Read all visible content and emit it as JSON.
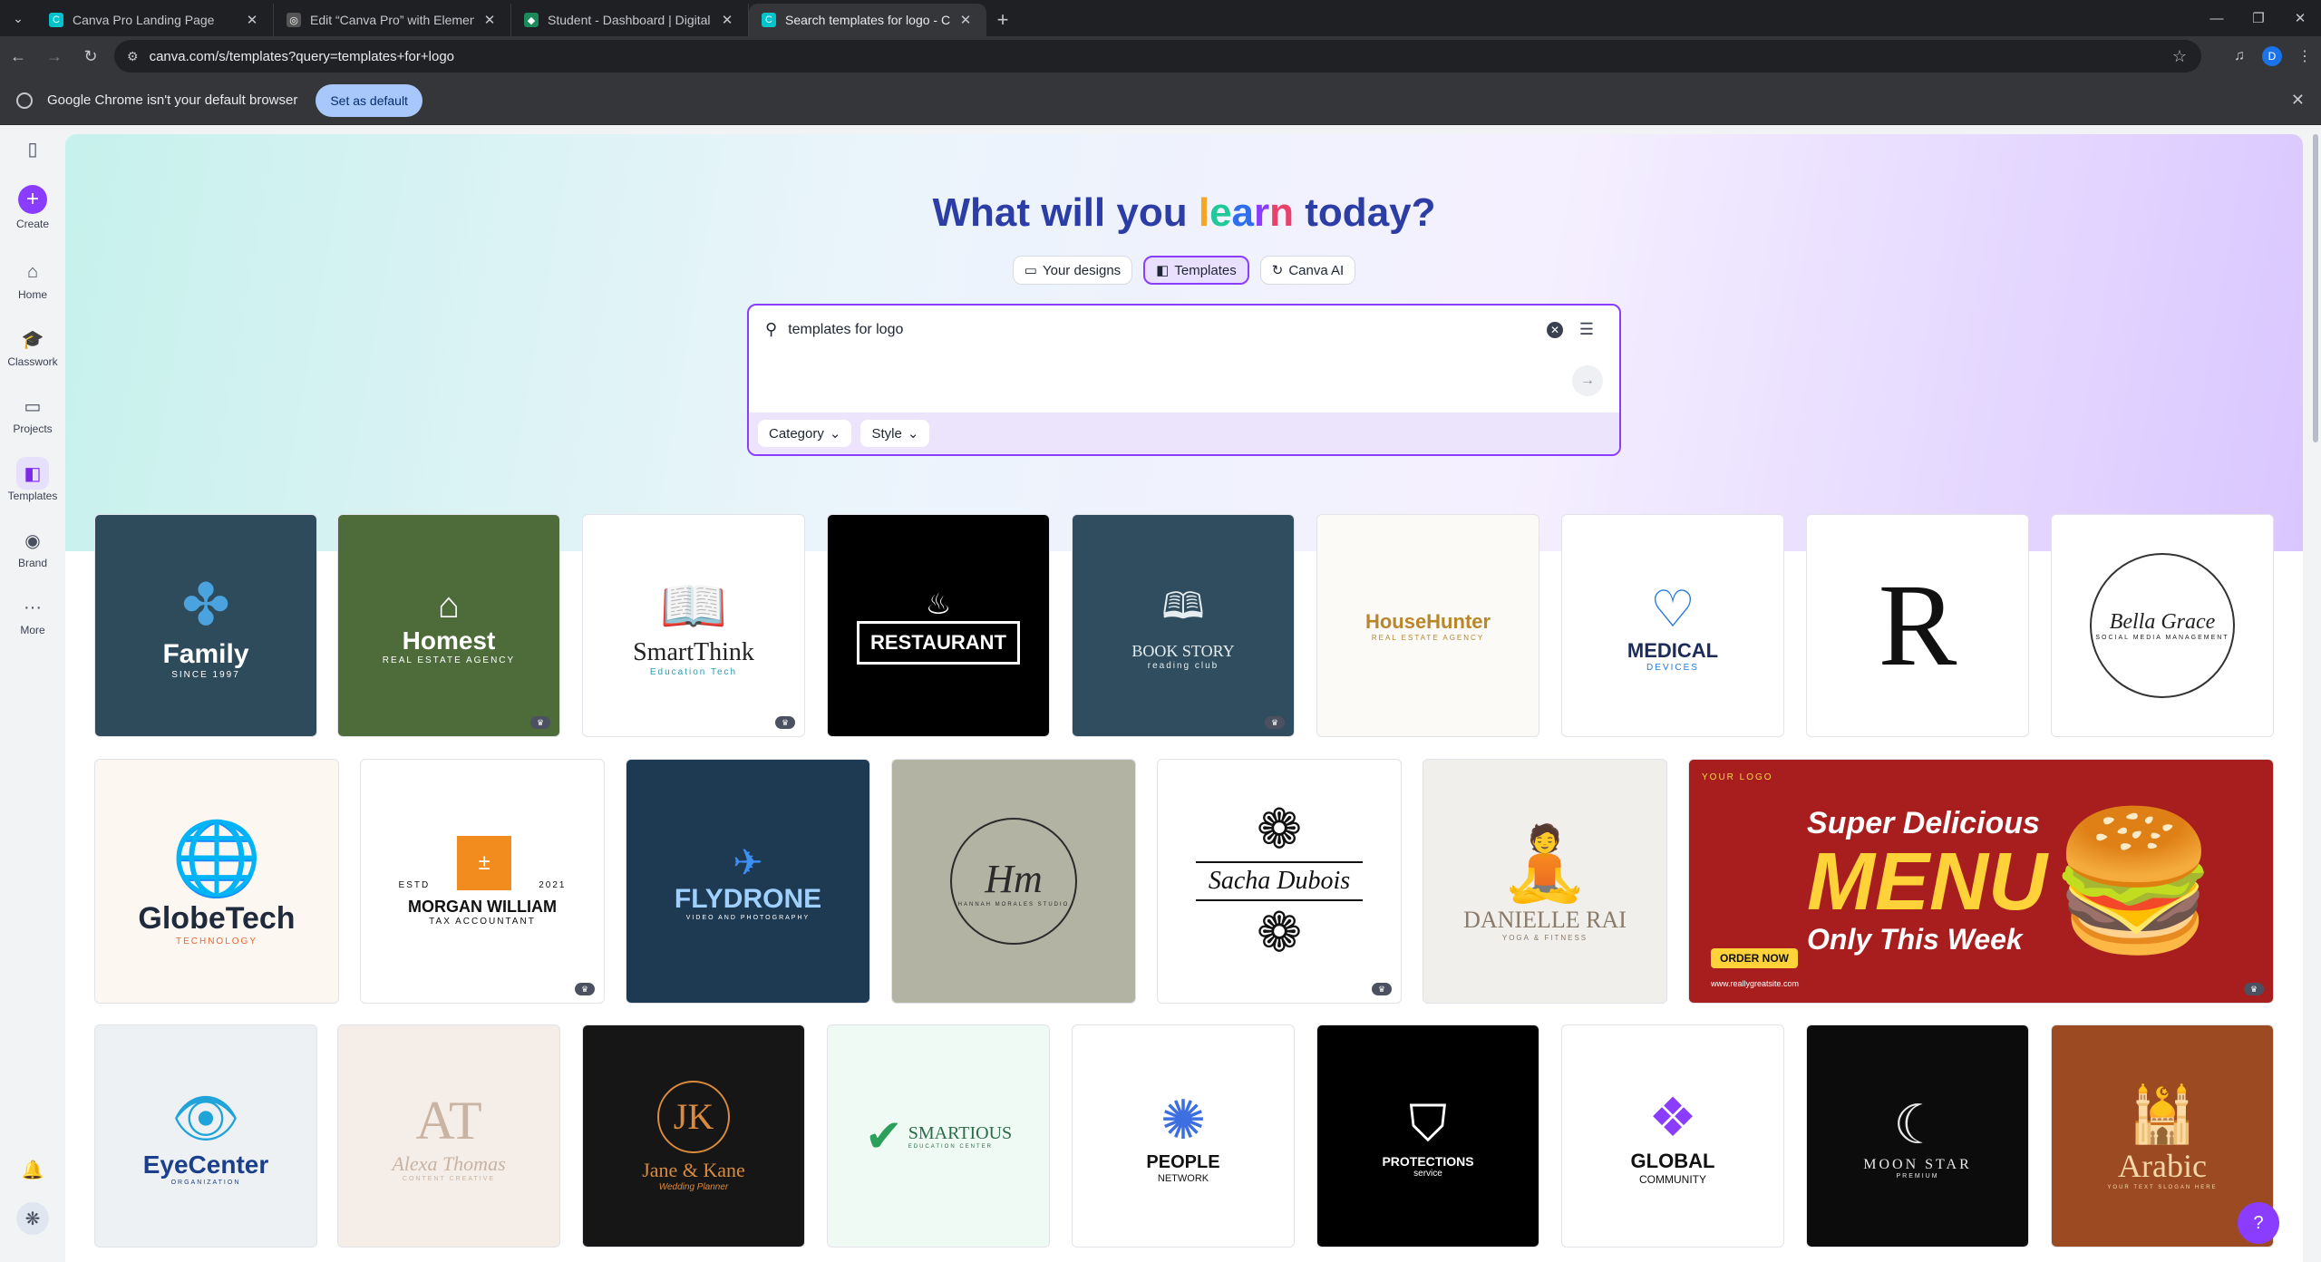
{
  "browser": {
    "tabs": [
      {
        "title": "Canva Pro Landing Page",
        "active": false
      },
      {
        "title": "Edit “Canva Pro” with Elementor",
        "active": false
      },
      {
        "title": "Student - Dashboard | Digital T",
        "active": false
      },
      {
        "title": "Search templates for logo - Can",
        "active": true
      }
    ],
    "url": "canva.com/s/templates?query=templates+for+logo",
    "profile_initial": "D",
    "infobar": {
      "message": "Google Chrome isn't your default browser",
      "button": "Set as default"
    }
  },
  "sidebar": {
    "items": [
      {
        "label": "Create",
        "icon": "plus-icon"
      },
      {
        "label": "Home",
        "icon": "home-icon"
      },
      {
        "label": "Classwork",
        "icon": "graduation-cap-icon"
      },
      {
        "label": "Projects",
        "icon": "folder-icon"
      },
      {
        "label": "Templates",
        "icon": "templates-icon",
        "active": true
      },
      {
        "label": "Brand",
        "icon": "brand-icon"
      },
      {
        "label": "More",
        "icon": "more-icon"
      }
    ]
  },
  "hero": {
    "headline_pre": "What will you",
    "headline_word": [
      "l",
      "e",
      "a",
      "r",
      "n"
    ],
    "headline_post": "today?",
    "pills": [
      "Your designs",
      "Templates",
      "Canva AI"
    ],
    "search_value": "templates for logo",
    "chips": [
      "Category",
      "Style"
    ]
  },
  "templates": {
    "row1": [
      {
        "title": "Family",
        "sub": "SINCE 1997"
      },
      {
        "title": "Homest",
        "sub": "REAL ESTATE AGENCY"
      },
      {
        "title": "SmartThink",
        "sub": "Education Tech"
      },
      {
        "title": "RESTAURANT",
        "sub": ""
      },
      {
        "title": "BOOK STORY",
        "sub": "reading club"
      },
      {
        "title": "HouseHunter",
        "sub": "REAL ESTATE AGENCY"
      },
      {
        "title": "MEDICAL",
        "sub": "DEVICES"
      },
      {
        "title": "R",
        "sub": ""
      },
      {
        "title": "Bella Grace",
        "sub": "SOCIAL MEDIA MANAGEMENT"
      }
    ],
    "row2": [
      {
        "title": "GlobeTech",
        "sub": "TECHNOLOGY"
      },
      {
        "title": "MORGAN WILLIAM",
        "sub": "TAX ACCOUNTANT",
        "left": "ESTD",
        "right": "2021"
      },
      {
        "title": "FLYDRONE",
        "sub": "VIDEO AND PHOTOGRAPHY"
      },
      {
        "title": "Hm",
        "sub": "HANNAH MORALES STUDIO"
      },
      {
        "title": "Sacha Dubois",
        "sub": ""
      },
      {
        "title": "DANIELLE RAI",
        "sub": "YOGA & FITNESS"
      },
      {
        "title": "Super Delicious",
        "big": "MENU",
        "tag": "Only This Week",
        "cta": "ORDER NOW",
        "logo": "YOUR LOGO",
        "site": "www.reallygreatsite.com"
      }
    ],
    "row3": [
      {
        "title": "EyeCenter",
        "sub": "ORGANIZATION"
      },
      {
        "title": "Alexa Thomas",
        "sub": "CONTENT CREATIVE",
        "mono": "AT"
      },
      {
        "title": "Jane & Kane",
        "sub": "Wedding Planner",
        "mono": "JK"
      },
      {
        "title": "SMARTIOUS",
        "sub": "EDUCATION CENTER"
      },
      {
        "title": "PEOPLE",
        "sub": "NETWORK"
      },
      {
        "title": "PROTECTIONS",
        "sub": "service"
      },
      {
        "title": "GLOBAL",
        "sub": "COMMUNITY"
      },
      {
        "title": "MOON STAR",
        "sub": "PREMIUM"
      },
      {
        "title": "Arabic",
        "sub": "YOUR TEXT SLOGAN HERE"
      }
    ]
  },
  "help_label": "?"
}
